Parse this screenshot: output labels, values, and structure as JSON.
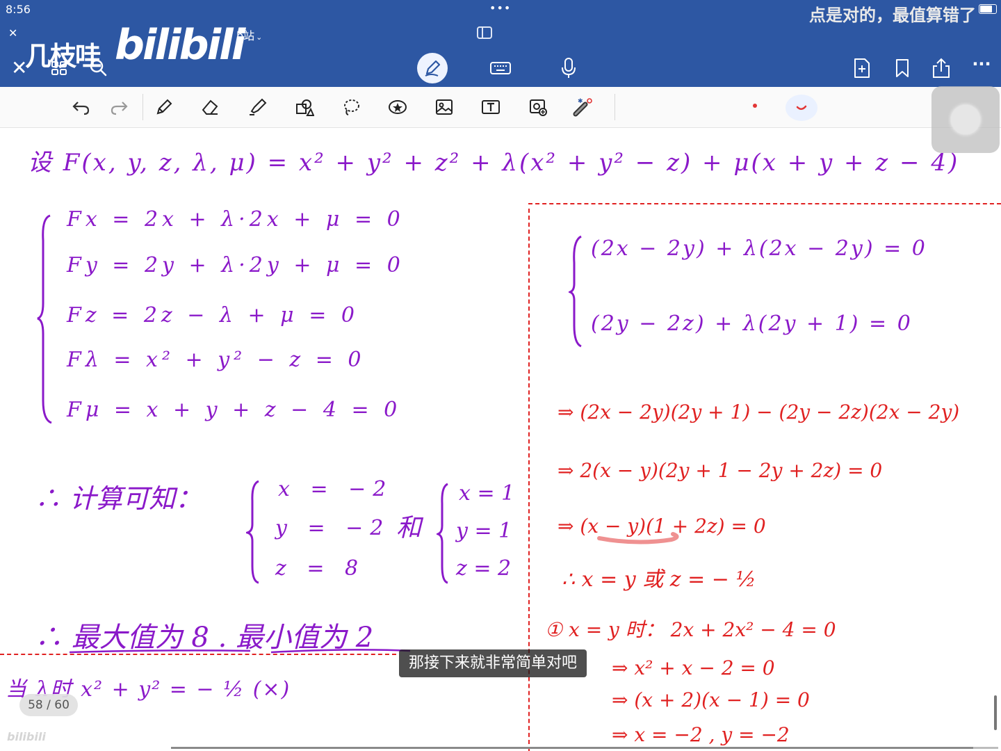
{
  "status_bar": {
    "time": "8:56",
    "dots": "•••",
    "overlay_text": "点是对的，最值算错了"
  },
  "top_bar": {
    "logo_text": "几枝哇",
    "brand_text": "bilibili",
    "notebook_name": "b站",
    "icons": [
      "close-icon",
      "grid-icon",
      "search-icon",
      "chevron-down-icon",
      "sidebar-icon",
      "pen-mode-icon",
      "keyboard-icon",
      "microphone-icon",
      "add-page-icon",
      "bookmark-icon",
      "share-icon",
      "more-icon"
    ],
    "more_label": "···",
    "accent_color": "#2d57a3"
  },
  "toolbar": {
    "tools": [
      "undo-icon",
      "redo-icon",
      "pen-icon",
      "eraser-icon",
      "highlighter-icon",
      "shapes-icon",
      "lasso-icon",
      "sticker-icon",
      "image-icon",
      "text-icon",
      "camera-icon",
      "bluetooth-pencil-icon"
    ],
    "current_color": "#e23636"
  },
  "note": {
    "line1": "设 F(x, y, z, λ, μ) = x² + y² + z² + λ(x² + y² − z) + μ(x + y + z − 4)",
    "system": [
      "Fx  =  2x  +  λ·2x  +  μ  =  0",
      "Fy  =  2y  +  λ·2y  +  μ  =  0",
      "Fz  =  2z  −  λ  +  μ  =  0",
      "Fλ  =  x² + y² − z  =  0",
      "Fμ  =  x + y + z − 4  =  0"
    ],
    "calc_label": "∴ 计算可知：",
    "solution1": [
      "x = −2",
      "y = −2",
      "z = 8"
    ],
    "and_label": "和",
    "solution2": [
      "x = 1",
      "y = 1",
      "z = 2"
    ],
    "conclusion": "∴ 最大值为 8 .  最小值为 2",
    "bottom_left": "当 λ时   x² + y² = − ½     (×)",
    "right": {
      "eq1": "(2x − 2y) + λ(2x − 2y) = 0",
      "eq2": "(2y − 2z) + λ(2y + 1) = 0",
      "step1": "⇒ (2x − 2y)(2y + 1) − (2y − 2z)(2x − 2y)",
      "step2": "⇒ 2(x − y)(2y + 1 − 2y + 2z) = 0",
      "step3": "⇒ (x − y)(1 + 2z) = 0",
      "therefore": "∴ x = y  或  z = − ½",
      "case1": "① x = y 时：  2x + 2x² − 4 = 0",
      "case1_s1": "⇒   x² + x − 2 = 0",
      "case1_s2": "⇒  (x + 2)(x − 1) = 0",
      "case1_s3": "⇒   x = −2 ,  y = −2"
    }
  },
  "ink_colors": {
    "purple": "#8a19c9",
    "red": "#e02121"
  },
  "subtitle": "那接下来就非常简单对吧",
  "page_counter": "58 / 60",
  "watermark": "bilibili",
  "progress": 0.97
}
